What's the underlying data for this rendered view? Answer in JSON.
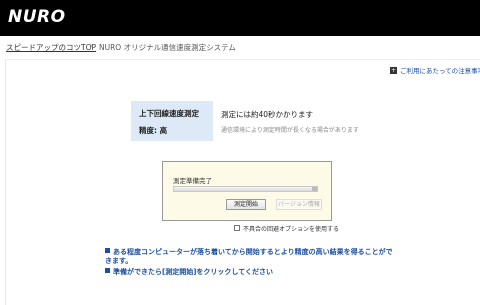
{
  "header": {
    "logo": "NURO"
  },
  "breadcrumb": {
    "home": "スピードアップのコツTOP",
    "separator": "›",
    "current": "NURO オリジナル通信速度測定システム"
  },
  "notice": {
    "icon": "plus-icon",
    "label": "ご利用にあたっての注意事項"
  },
  "info": {
    "line1": "上下回線速度測定",
    "line2": "精度: 高",
    "time_main": "測定には約40秒かかります",
    "time_sub": "通信環境により測定時間が長くなる場合があります"
  },
  "panel": {
    "status": "測定準備完了",
    "progress": 0,
    "start_button": "測定開始",
    "version_button": "バージョン情報"
  },
  "option": {
    "checked": false,
    "label": "不具合の回避オプションを使用する"
  },
  "notes": [
    "ある程度コンピューターが落ち着いてから開始するとより精度の高い結果を得ることができます。",
    "準備ができたら[測定開始]をクリックしてください"
  ],
  "colors": {
    "header_bg": "#000000",
    "accent_blue": "#1c4fa0",
    "info_box": "#dde9f7",
    "panel_bg": "#fdfbe7"
  }
}
